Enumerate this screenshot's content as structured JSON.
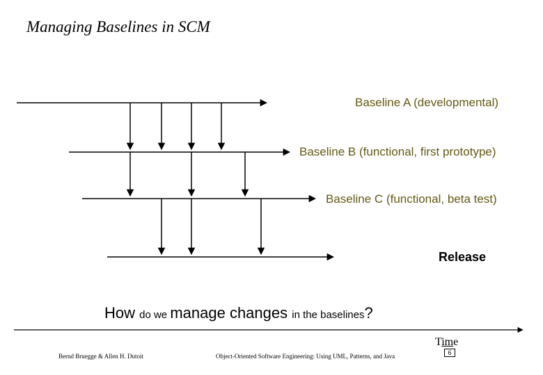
{
  "title": "Managing Baselines in SCM",
  "rows": {
    "a": "Baseline A (developmental)",
    "b": "Baseline B (functional, first prototype)",
    "c": "Baseline C (functional, beta test)",
    "release": "Release"
  },
  "question": {
    "w1": "How ",
    "w2": "do we ",
    "w3": "manage changes ",
    "w4": "in the baselines",
    "w5": "?"
  },
  "time_label": {
    "t": "T",
    "ime": "im",
    "e": "e"
  },
  "page_number": "6",
  "footer": {
    "left": "Bernd Bruegge & Allen H. Dutoit",
    "center": "Object-Oriented Software Engineering: Using UML, Patterns, and Java"
  },
  "chart_data": {
    "type": "diagram",
    "title": "Managing Baselines in SCM",
    "baselines": [
      {
        "name": "Baseline A (developmental)",
        "timeline_start": 24,
        "timeline_end": 382,
        "drops_to_next_at": [
          187,
          232,
          275,
          318
        ]
      },
      {
        "name": "Baseline B (functional, first prototype)",
        "timeline_start": 99,
        "timeline_end": 415,
        "drops_to_next_at": [
          187,
          275,
          352
        ]
      },
      {
        "name": "Baseline C (functional, beta test)",
        "timeline_start": 118,
        "timeline_end": 452,
        "drops_to_next_at": [
          232,
          275,
          375
        ]
      },
      {
        "name": "Release",
        "timeline_start": 154,
        "timeline_end": 478,
        "drops_to_next_at": []
      }
    ],
    "time_axis": {
      "start": 20,
      "end": 750
    },
    "annotation": "How do we manage changes in the baselines?"
  }
}
